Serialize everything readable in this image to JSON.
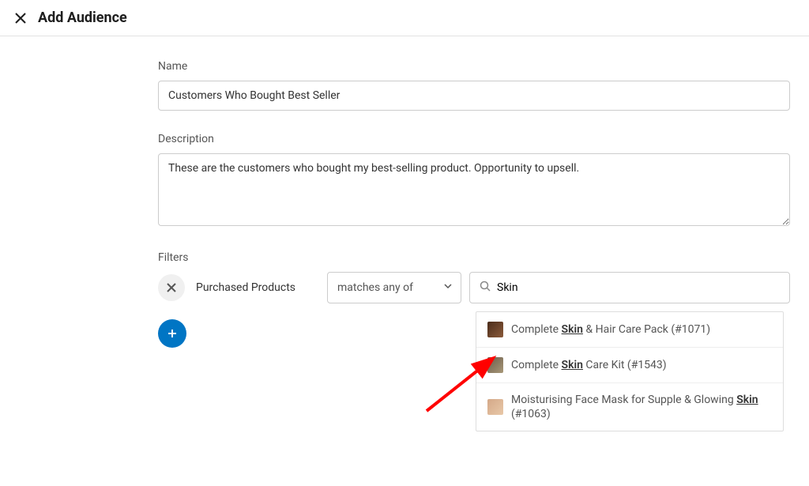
{
  "header": {
    "title": "Add Audience"
  },
  "form": {
    "name_label": "Name",
    "name_value": "Customers Who Bought Best Seller",
    "description_label": "Description",
    "description_value": "These are the customers who bought my best-selling product. Opportunity to upsell.",
    "filters_label": "Filters"
  },
  "filter": {
    "type": "Purchased Products",
    "operator": "matches any of",
    "search_value": "Skin"
  },
  "dropdown": {
    "items": [
      {
        "prefix": "Complete ",
        "match": "Skin",
        "suffix": " & Hair Care Pack (#1071)",
        "thumb_color": "#6b3a2a"
      },
      {
        "prefix": "Complete ",
        "match": "Skin",
        "suffix": " Care Kit (#1543)",
        "thumb_color": "#7a6b5a"
      },
      {
        "prefix": "Moisturising Face Mask for Supple & Glowing ",
        "match": "Skin",
        "suffix": " (#1063)",
        "thumb_color": "#c49a7a"
      }
    ]
  }
}
